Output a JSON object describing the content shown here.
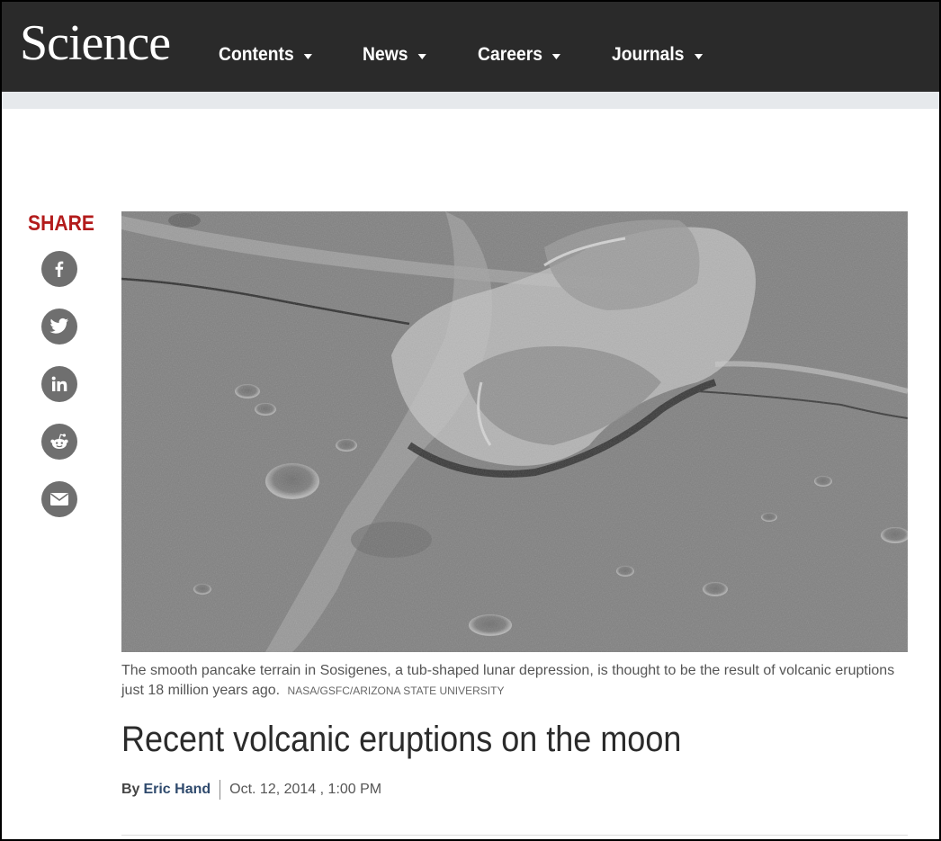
{
  "header": {
    "logo": "Science",
    "nav": [
      {
        "label": "Contents"
      },
      {
        "label": "News"
      },
      {
        "label": "Careers"
      },
      {
        "label": "Journals"
      }
    ]
  },
  "share": {
    "label": "SHARE",
    "buttons": [
      {
        "icon": "facebook-icon"
      },
      {
        "icon": "twitter-icon"
      },
      {
        "icon": "linkedin-icon"
      },
      {
        "icon": "reddit-icon"
      },
      {
        "icon": "email-icon"
      }
    ]
  },
  "article": {
    "caption": "The smooth pancake terrain in Sosigenes, a tub-shaped lunar depression, is thought to be the result of volcanic eruptions just 18 million years ago.",
    "credit": "NASA/GSFC/ARIZONA STATE UNIVERSITY",
    "title": "Recent volcanic eruptions on the moon",
    "by_prefix": "By",
    "author": "Eric Hand",
    "date": "Oct. 12, 2014 , 1:00 PM"
  },
  "colors": {
    "header_bg": "#2a2a2a",
    "share_red": "#b31b1b",
    "author_blue": "#2f4a6d"
  }
}
